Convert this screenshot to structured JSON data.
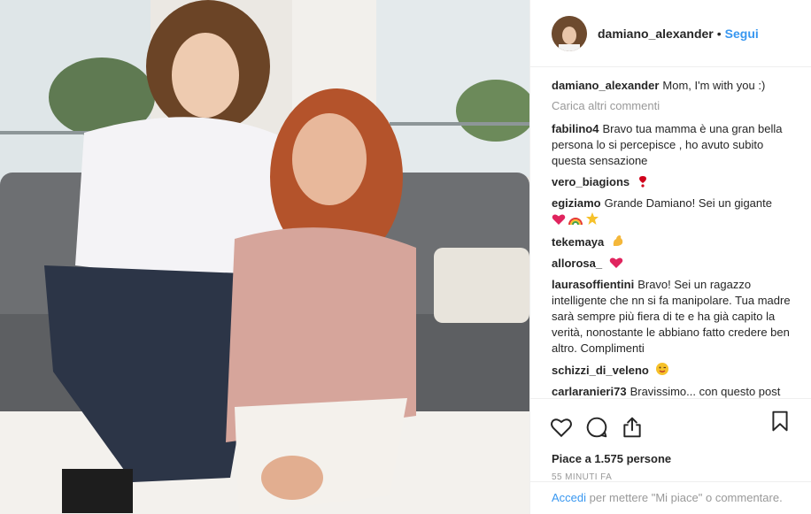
{
  "post": {
    "username": "damiano_alexander",
    "follow_label": "Segui",
    "separator": "•"
  },
  "caption": {
    "user": "damiano_alexander",
    "text": "Mom, I'm with you :)"
  },
  "load_more_label": "Carica altri commenti",
  "comments": [
    {
      "user": "fabilino4",
      "text": "Bravo tua mamma è una gran bella persona lo si percepisce , ho avuto subito questa sensazione",
      "emoji": []
    },
    {
      "user": "vero_biagions",
      "text": "",
      "emoji": [
        "heart-exclamation"
      ]
    },
    {
      "user": "egiziamo",
      "text": "Grande Damiano! Sei un gigante",
      "emoji": [
        "heart",
        "rainbow",
        "star"
      ]
    },
    {
      "user": "tekemaya",
      "text": "",
      "emoji": [
        "muscle"
      ]
    },
    {
      "user": "allorosa_",
      "text": "",
      "emoji": [
        "heart"
      ]
    },
    {
      "user": "laurasoffientini",
      "text": "Bravo! Sei un ragazzo intelligente che nn si fa manipolare. Tua madre sarà sempre più fiera di te e ha già capito la verità, nonostante le abbiano fatto credere ben altro. Complimenti",
      "emoji": []
    },
    {
      "user": "schizzi_di_veleno",
      "text": "",
      "emoji": [
        "wink-face"
      ]
    },
    {
      "user": "carlaranieri73",
      "text": "Bravissimo... con questo post",
      "emoji": []
    }
  ],
  "actions": {
    "like_icon": "heart-outline-icon",
    "comment_icon": "comment-bubble-icon",
    "share_icon": "share-icon",
    "save_icon": "bookmark-icon"
  },
  "likes_text": "Piace a 1.575 persone",
  "timestamp": "55 MINUTI FA",
  "footer": {
    "login_link": "Accedi",
    "rest_text": "per mettere \"Mi piace\" o commentare."
  },
  "colors": {
    "link": "#3897f0",
    "text": "#262626",
    "muted": "#999999",
    "border": "#efefef"
  }
}
